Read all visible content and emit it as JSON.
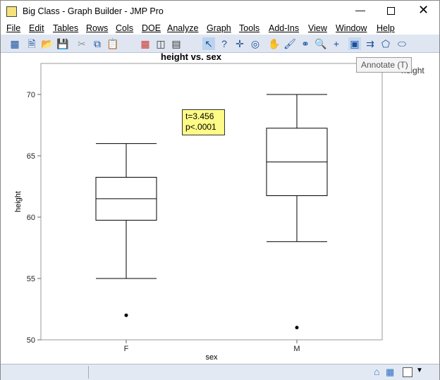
{
  "window": {
    "title": "Big Class - Graph Builder - JMP Pro"
  },
  "menu": [
    "File",
    "Edit",
    "Tables",
    "Rows",
    "Cols",
    "DOE",
    "Analyze",
    "Graph",
    "Tools",
    "Add-Ins",
    "View",
    "Window",
    "Help"
  ],
  "toolbar": {
    "tooltip": "Annotate (T)"
  },
  "legend": {
    "label": "height"
  },
  "annotation": {
    "line1": "t=3.456",
    "line2": "p<.0001"
  },
  "chart_data": {
    "type": "box",
    "title": "height vs. sex",
    "xlabel": "sex",
    "ylabel": "height",
    "ylim": [
      50,
      72
    ],
    "yticks": [
      50,
      55,
      60,
      65,
      70
    ],
    "categories": [
      "F",
      "M"
    ],
    "boxes": [
      {
        "category": "F",
        "whisker_low": 55,
        "q1": 59.75,
        "median": 61.5,
        "q3": 63.25,
        "whisker_high": 66,
        "outliers": [
          52
        ]
      },
      {
        "category": "M",
        "whisker_low": 58,
        "q1": 61.75,
        "median": 64.5,
        "q3": 67.25,
        "whisker_high": 70,
        "outliers": [
          51
        ]
      }
    ]
  }
}
